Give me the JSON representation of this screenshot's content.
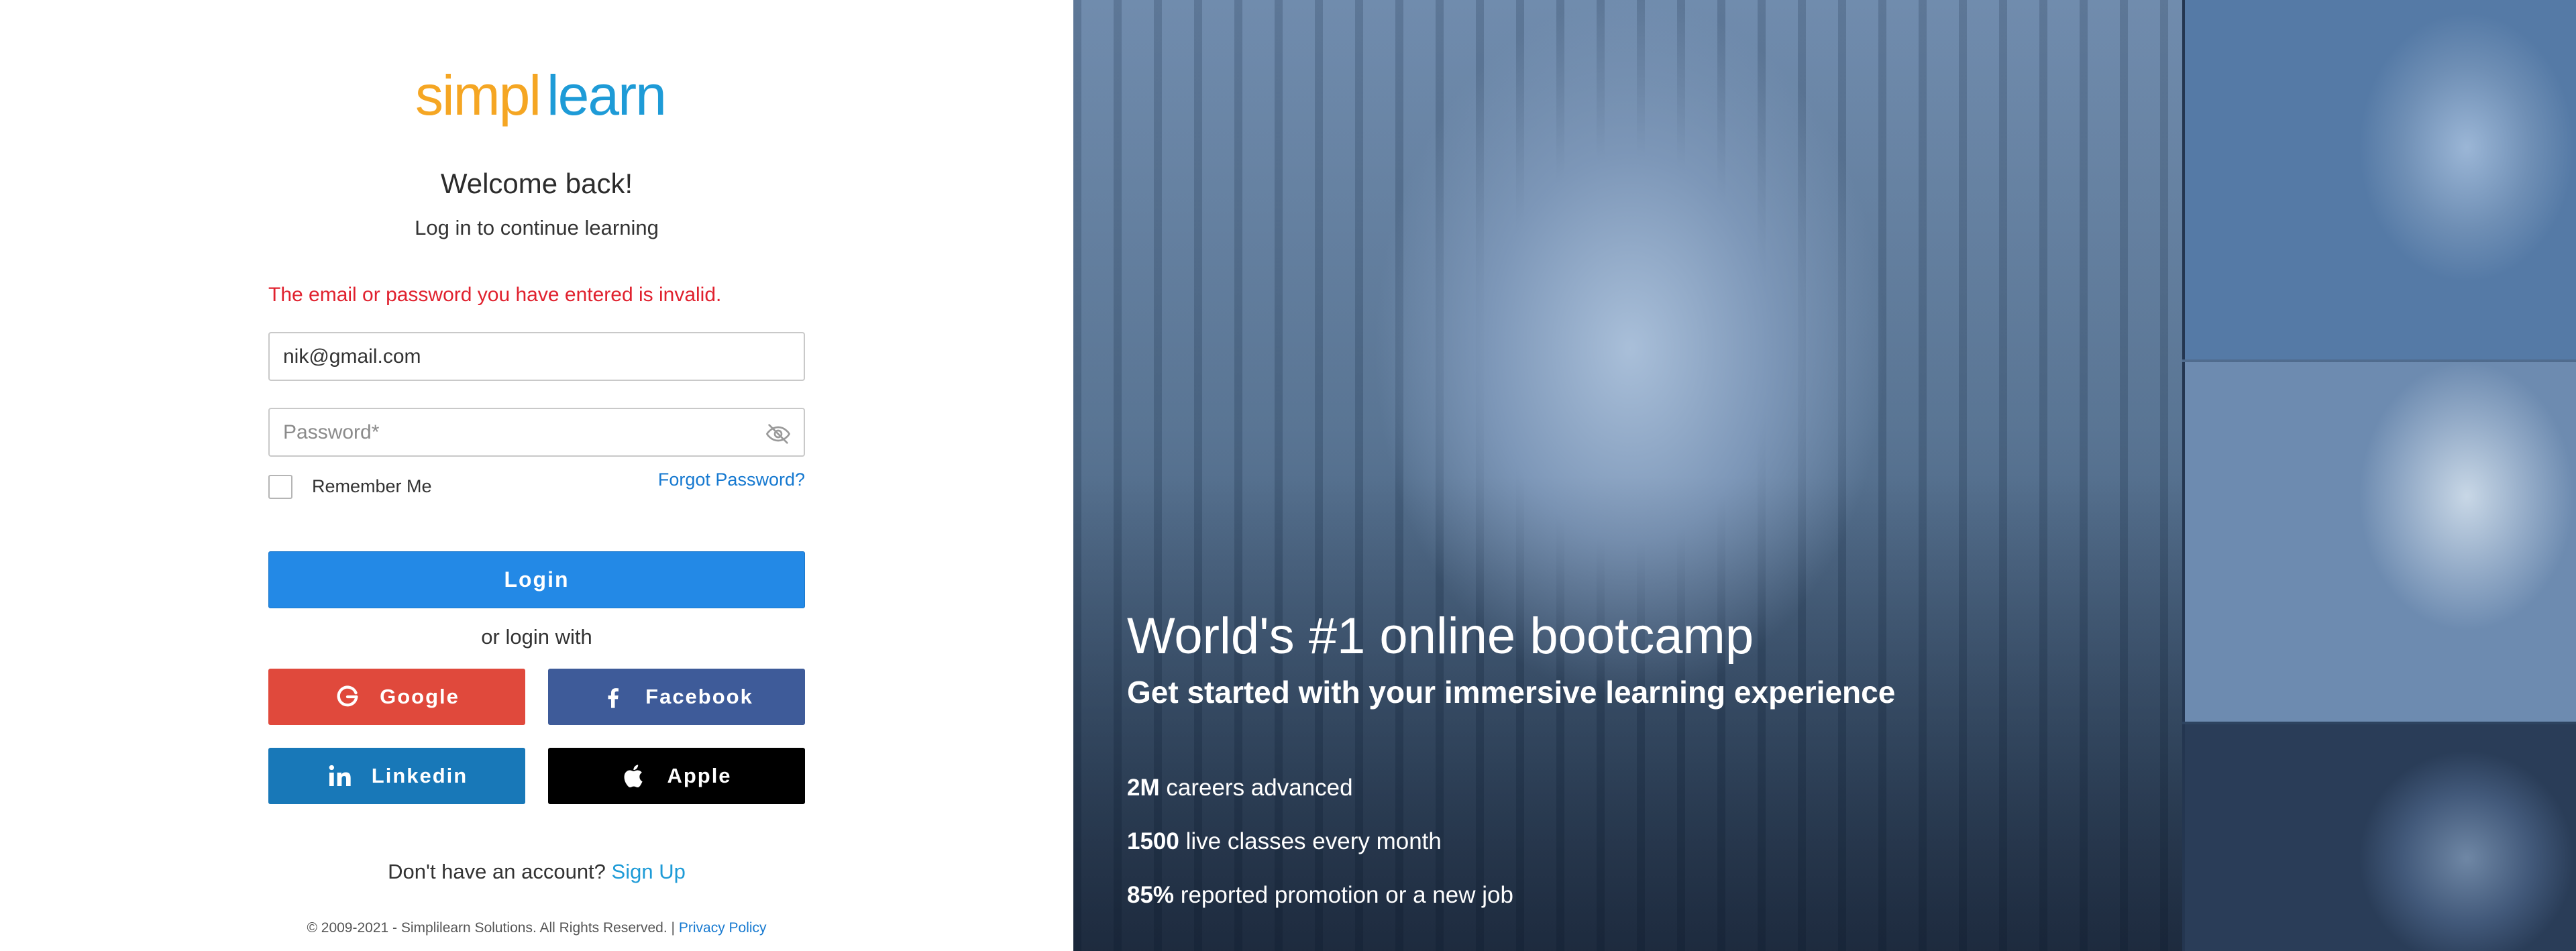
{
  "brand": {
    "logo_part1": "simpl",
    "logo_part2": "learn"
  },
  "form": {
    "heading": "Welcome back!",
    "subheading": "Log in to continue learning",
    "error_message": "The email or password you have entered is invalid.",
    "email_value": "nik@gmail.com",
    "password_placeholder": "Password*",
    "remember_label": "Remember Me",
    "remember_checked": false,
    "forgot_label": "Forgot Password?",
    "login_label": "Login",
    "or_login_with": "or login with",
    "signup_prompt": "Don't have an account?",
    "signup_label": "Sign Up"
  },
  "social": {
    "google": "Google",
    "facebook": "Facebook",
    "linkedin": "Linkedin",
    "apple": "Apple"
  },
  "footer": {
    "copyright": "© 2009-2021 - Simplilearn Solutions. All Rights Reserved. |",
    "privacy_label": "Privacy Policy"
  },
  "hero": {
    "title": "World's #1 online bootcamp",
    "subtitle": "Get started with your immersive learning experience",
    "stats": [
      {
        "value": "2M",
        "text": "careers advanced"
      },
      {
        "value": "1500",
        "text": "live classes every month"
      },
      {
        "value": "85%",
        "text": "reported promotion or a new job"
      }
    ]
  },
  "colors": {
    "logo_orange": "#f5a623",
    "logo_blue": "#1e9bd7",
    "error_red": "#e0212e",
    "login_blue": "#2389e6",
    "google_red": "#e0493c",
    "facebook_blue": "#3e5b99",
    "linkedin_blue": "#1878b8",
    "apple_black": "#000000"
  },
  "icons": {
    "password_toggle": "eye-off-icon",
    "google": "google-icon",
    "facebook": "facebook-icon",
    "linkedin": "linkedin-icon",
    "apple": "apple-icon"
  }
}
